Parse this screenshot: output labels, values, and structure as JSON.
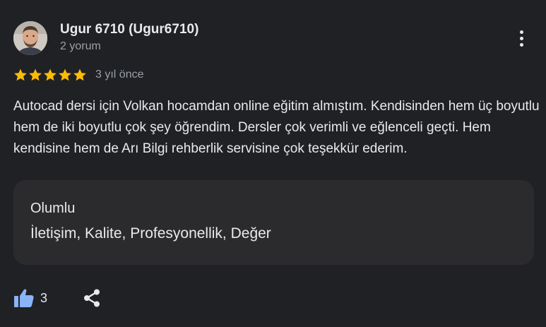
{
  "review": {
    "author": {
      "name": "Ugur 6710 (Ugur6710)",
      "review_count": "2 yorum"
    },
    "rating": 5,
    "date": "3 yıl önce",
    "text": "Autocad dersi için Volkan hocamdan online eğitim almıştım. Kendisinden hem üç boyutlu hem de iki boyutlu çok şey öğrendim. Dersler çok verimli ve eğlenceli geçti. Hem kendisine hem de Arı Bilgi rehberlik servisine çok teşekkür ederim.",
    "attributes": {
      "heading": "Olumlu",
      "values": "İletişim, Kalite, Profesyonellik, Değer"
    },
    "likes": "3",
    "icons": {
      "more": "more-vert-icon",
      "star": "star-icon",
      "like": "thumb-up-icon",
      "share": "share-icon"
    },
    "colors": {
      "background": "#202124",
      "star": "#fbbc04",
      "like": "#8ab4f8",
      "card": "#2b2b2d"
    }
  }
}
